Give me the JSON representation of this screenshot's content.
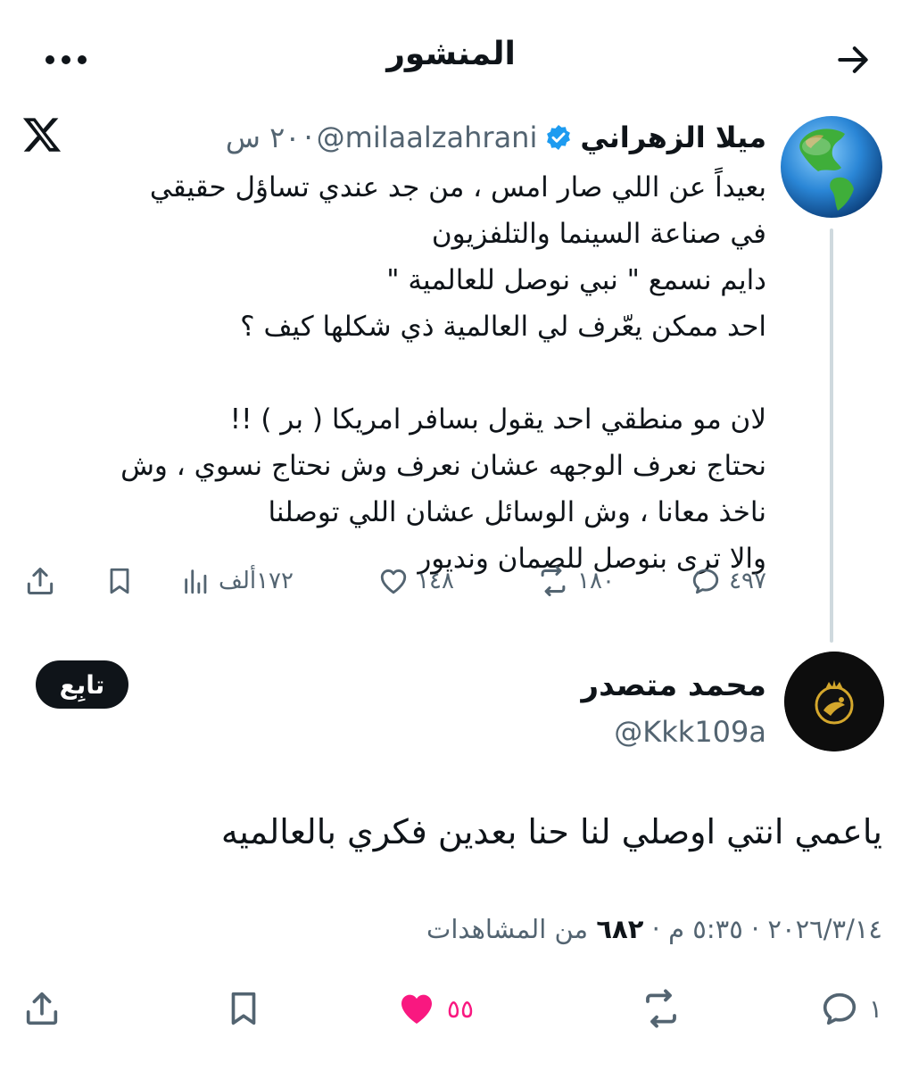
{
  "header": {
    "title": "المنشور"
  },
  "post": {
    "author_name": "ميلا الزهراني",
    "handle": "@milaalzahrani",
    "time": "٢٠ س",
    "separator": "·",
    "body": "بعيداً عن اللي صار امس ، من جد عندي تساؤل حقيقي\nفي صناعة السينما والتلفزيون\nدايم نسمع \" نبي نوصل للعالمية \"\nاحد ممكن يعّرف لي العالمية ذي شكلها كيف ؟\n\nلان مو منطقي احد يقول بسافر امريكا ( بر ) !!\nنحتاج نعرف الوجهه عشان نعرف وش نحتاج نسوي ، وش\nناخذ معانا ، وش الوسائل عشان اللي توصلنا\nوالا ترى بنوصل للصمان ونديور",
    "stats": {
      "replies": "٤٩٧",
      "reposts": "١٨٠",
      "likes": "١٤٨",
      "views": "١٧٢ألف"
    }
  },
  "reply": {
    "author_name": "محمد متصدر",
    "handle": "@Kkk109a",
    "follow_label": "تابِع",
    "body": "ياعمي انتي اوصلي لنا حنا بعدين فكري بالعالميه",
    "date": "٢٠٢٦/٣/١٤",
    "time": "٥:٣٥ م",
    "views_count": "٦٨٢",
    "views_label": "من المشاهدات",
    "stats": {
      "replies": "١",
      "likes": "٥٥"
    }
  },
  "colors": {
    "text": "#0f1419",
    "secondary": "#536471",
    "like": "#f91880",
    "verified": "#1d9bf0",
    "thread_line": "#cfd9de"
  },
  "icons": [
    "back-arrow-icon",
    "more-icon",
    "x-logo-icon",
    "verified-badge-icon",
    "reply-icon",
    "repost-icon",
    "like-icon",
    "views-icon",
    "bookmark-icon",
    "share-icon"
  ]
}
